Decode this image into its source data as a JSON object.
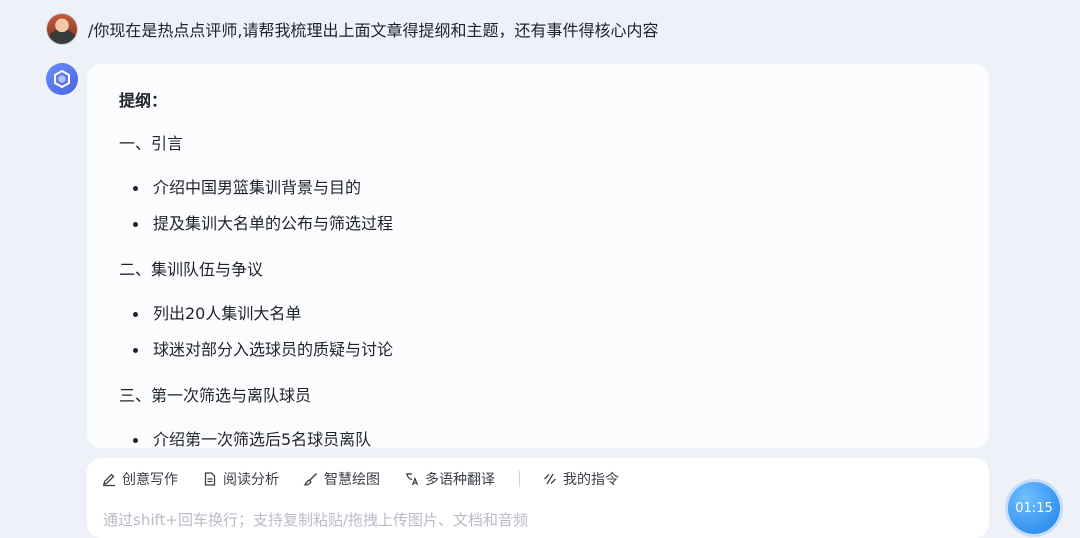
{
  "user_message": {
    "text": "/你现在是热点点评师,请帮我梳理出上面文章得提纲和主题，还有事件得核心内容"
  },
  "answer": {
    "outline_title": "提纲：",
    "sections": [
      {
        "heading": "一、引言",
        "bullets": [
          "介绍中国男篮集训背景与目的",
          "提及集训大名单的公布与筛选过程"
        ]
      },
      {
        "heading": "二、集训队伍与争议",
        "bullets": [
          "列出20人集训大名单",
          "球迷对部分入选球员的质疑与讨论"
        ]
      },
      {
        "heading": "三、第一次筛选与离队球员",
        "bullets": [
          "介绍第一次筛选后5名球员离队"
        ]
      }
    ]
  },
  "toolbar": {
    "items": [
      {
        "label": "创意写作",
        "icon": "pen-icon"
      },
      {
        "label": "阅读分析",
        "icon": "document-icon"
      },
      {
        "label": "智慧绘图",
        "icon": "brush-icon"
      },
      {
        "label": "多语种翻译",
        "icon": "translate-icon"
      },
      {
        "label": "我的指令",
        "icon": "command-icon"
      }
    ]
  },
  "composer": {
    "placeholder": "通过shift+回车换行；支持复制粘贴/拖拽上传图片、文档和音频"
  },
  "timer": {
    "text": "01:15"
  }
}
